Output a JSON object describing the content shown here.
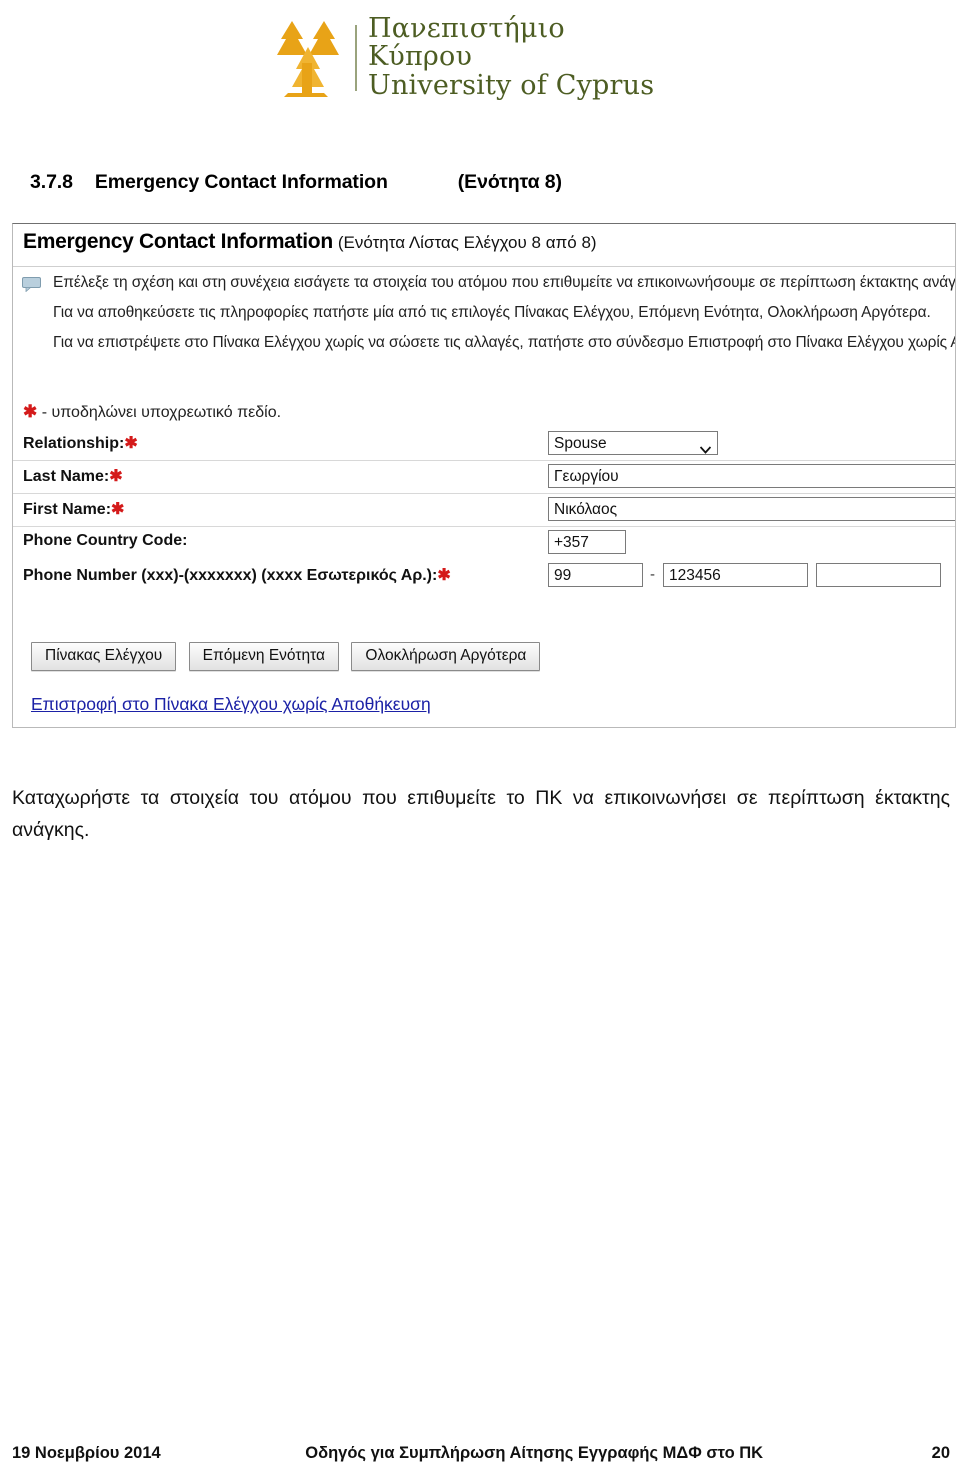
{
  "logo": {
    "greek_name": "Πανεπιστήμιο Κύπρου",
    "english_name": "University of Cyprus",
    "mark_icon": "tree-logo-icon",
    "mark_color": "#e8a317",
    "text_color": "#4d5d23"
  },
  "heading": {
    "number": "3.7.8",
    "title": "Emergency Contact Information",
    "greek_section": "(Ενότητα 8)"
  },
  "screenshot": {
    "title": "Emergency Contact Information",
    "title_suffix": "(Ενότητα Λίστας Ελέγχου 8 από 8)",
    "bubble_icon": "speech-bubble-icon",
    "instructions": [
      "Επέλεξε τη σχέση και στη συνέχεια εισάγετε τα στοιχεία του ατόμου που επιθυμείτε να επικοινωνήσουμε σε περίπτωση έκτακτης ανάγκης.",
      "Για να αποθηκεύσετε τις πληροφορίες πατήστε μία από τις επιλογές Πίνακας Ελέγχου, Επόμενη Ενότητα, Ολοκλήρωση Αργότερα.",
      "Για να επιστρέψετε στο Πίνακα Ελέγχου χωρίς να σώσετε τις αλλαγές, πατήστε στο σύνδεσμο Επιστροφή στο Πίνακα Ελέγχου χωρίς Αποθήκευση."
    ],
    "required_note": "- υποδηλώνει υποχρεωτικό πεδίο.",
    "required_marker": "✱",
    "required_color": "#d41a1a",
    "fields": {
      "relationship": {
        "label": "Relationship:",
        "required": true,
        "value": "Spouse",
        "chevron_icon": "chevron-down-icon"
      },
      "last_name": {
        "label": "Last Name:",
        "required": true,
        "value": "Γεωργίου"
      },
      "first_name": {
        "label": "First Name:",
        "required": true,
        "value": "Νικόλαος"
      },
      "country_code": {
        "label": "Phone Country Code:",
        "required": false,
        "value": "+357"
      },
      "phone": {
        "label": "Phone Number (xxx)-(xxxxxxx) (xxxx Εσωτερικός Αρ.):",
        "required": true,
        "area": "99",
        "separator": "-",
        "number": "123456",
        "extension": ""
      }
    },
    "buttons": [
      "Πίνακας Ελέγχου",
      "Επόμενη Ενότητα",
      "Ολοκλήρωση Αργότερα"
    ],
    "back_link": "Επιστροφή στο Πίνακα Ελέγχου χωρίς Αποθήκευση",
    "link_color": "#1b21a6"
  },
  "body_paragraph": "Καταχωρήστε τα στοιχεία του ατόμου που επιθυμείτε το ΠΚ να επικοινωνήσει σε περίπτωση έκτακτης ανάγκης.",
  "footer": {
    "date": "19 Νοεμβρίου 2014",
    "title": "Οδηγός  για Συμπλήρωση Αίτησης Εγγραφής ΜΔΦ στο ΠΚ",
    "page": "20"
  }
}
